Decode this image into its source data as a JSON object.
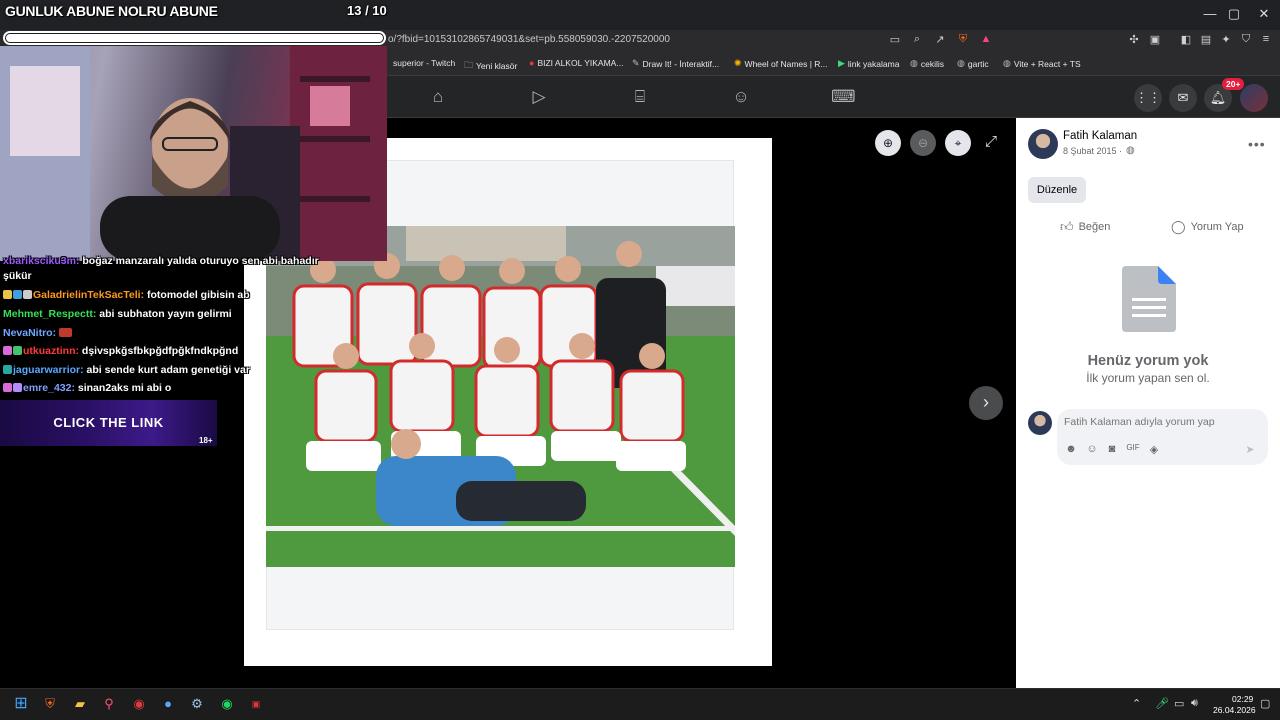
{
  "browser": {
    "url": "o/?fbid=10153102865749031&set=pb.558059030.-2207520000",
    "window_controls": [
      "—",
      "▢",
      "✕"
    ],
    "bookmarks": [
      {
        "label": "superior - Twitch",
        "icon": "twitch-icon"
      },
      {
        "label": "Yeni klasör",
        "icon": "folder-icon"
      },
      {
        "label": "BIZI ALKOL YIKAMA...",
        "icon": "site-icon"
      },
      {
        "label": "Draw It! - İnteraktif...",
        "icon": "pencil-icon"
      },
      {
        "label": "Wheel of Names | R...",
        "icon": "wheel-icon"
      },
      {
        "label": "link yakalama",
        "icon": "play-icon"
      },
      {
        "label": "cekilis",
        "icon": "globe-icon"
      },
      {
        "label": "gartic",
        "icon": "globe-icon"
      },
      {
        "label": "Vite + React + TS",
        "icon": "globe-icon"
      }
    ]
  },
  "facebook": {
    "notification_count": "20+"
  },
  "post": {
    "author": "Fatih Kalaman",
    "date": "8 Şubat 2015 ·",
    "edit_label": "Düzenle",
    "like_label": "Beğen",
    "comment_label": "Yorum Yap",
    "no_comments_title": "Henüz yorum yok",
    "no_comments_subtitle": "İlk yorum yapan sen ol.",
    "comment_placeholder": "Fatih Kalaman adıyla yorum yap"
  },
  "stream": {
    "title": "GUNLUK ABUNE NOLRU ABUNE",
    "count": "13 / 10",
    "progress_fraction": 1.0,
    "link_banner": "CLICK THE LINK",
    "age_rating": "18+",
    "chat": [
      {
        "user": "xbariksciku3m:",
        "user_color": "#9b59ff",
        "message": "boğaz manzaralı yalıda oturuyo sen abi bahadır",
        "badge_colors": []
      },
      {
        "user": "",
        "user_color": "#fff",
        "message": "şükür",
        "badge_colors": []
      },
      {
        "user": "GaladrielinTekSacTeli:",
        "user_color": "#ff9a1f",
        "message": "fotomodel gibisin ab",
        "badge_colors": [
          "#e8c34a",
          "#3fa0e0",
          "#cccccc"
        ]
      },
      {
        "user": "Mehmet_Respectt:",
        "user_color": "#36e05a",
        "message": "abi subhaton yayın gelirmi",
        "badge_colors": []
      },
      {
        "user": "NevaNitro:",
        "user_color": "#6ea8ff",
        "message": "",
        "badge_colors": [],
        "trailing_badge": "#c0392b"
      },
      {
        "user": "utkuaztinn:",
        "user_color": "#ff3a3a",
        "message": "dşivspkğsfbkpğdfpğkfndkpğnd",
        "badge_colors": [
          "#d86bd8",
          "#43c36b"
        ]
      },
      {
        "user": "jaguarwarrior:",
        "user_color": "#5aa8ff",
        "message": "abi sende kurt adam genetiği var",
        "badge_colors": [
          "#2aa7a1"
        ]
      },
      {
        "user": "emre_432:",
        "user_color": "#7fa0ff",
        "message": "sinan2aks mi abi o",
        "badge_colors": [
          "#d86bd8",
          "#b28cff"
        ]
      }
    ]
  },
  "taskbar": {
    "time": "02:29",
    "date": "26.04.2026"
  }
}
